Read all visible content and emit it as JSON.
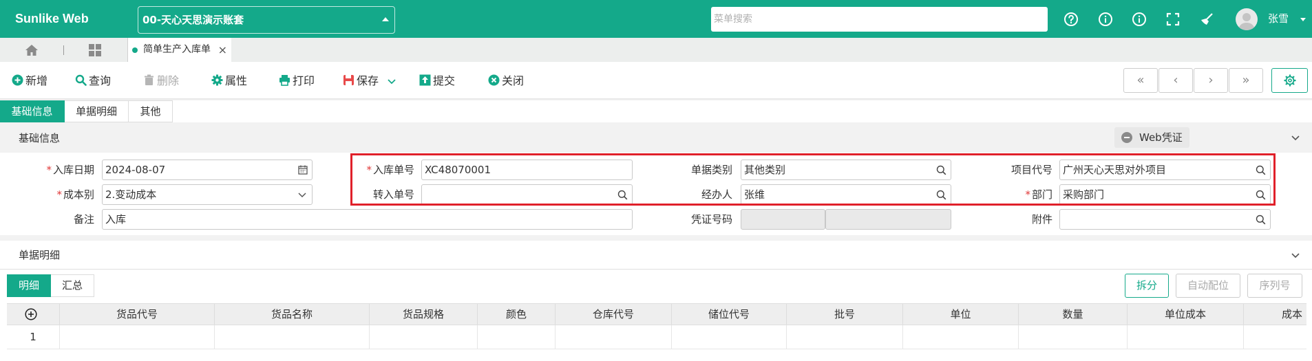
{
  "app": {
    "brand": "Sunlike Web",
    "account": "00-天心天思演示账套"
  },
  "search": {
    "placeholder": "菜单搜索"
  },
  "user": {
    "name": "张雪"
  },
  "tabs": {
    "document_tab": "简单生产入库单"
  },
  "toolbar": {
    "add": "新增",
    "query": "查询",
    "delete": "删除",
    "properties": "属性",
    "print": "打印",
    "save": "保存",
    "submit": "提交",
    "close": "关闭"
  },
  "section_tabs": [
    "基础信息",
    "单据明细",
    "其他"
  ],
  "basic_section": {
    "title": "基础信息",
    "voucher_button": "Web凭证"
  },
  "form": {
    "in_date": {
      "label": "入库日期",
      "value": "2024-08-07"
    },
    "cost_type": {
      "label": "成本别",
      "value": "2.变动成本"
    },
    "remark": {
      "label": "备注",
      "value": "入库"
    },
    "in_no": {
      "label": "入库单号",
      "value": "XC48070001"
    },
    "transfer_no": {
      "label": "转入单号",
      "value": ""
    },
    "doc_type": {
      "label": "单据类别",
      "value": "其他类别"
    },
    "handler": {
      "label": "经办人",
      "value": "张维"
    },
    "voucher_no": {
      "label": "凭证号码",
      "value": ""
    },
    "project_code": {
      "label": "项目代号",
      "value": "广州天心天思对外项目"
    },
    "dept": {
      "label": "部门",
      "value": "采购部门"
    },
    "attachment": {
      "label": "附件",
      "value": ""
    }
  },
  "detail_section": {
    "title": "单据明细"
  },
  "detail_tabs": [
    "明细",
    "汇总"
  ],
  "detail_buttons": {
    "split": "拆分",
    "auto_alloc": "自动配位",
    "serial": "序列号"
  },
  "table": {
    "columns": [
      "货品代号",
      "货品名称",
      "货品规格",
      "颜色",
      "仓库代号",
      "储位代号",
      "批号",
      "单位",
      "数量",
      "单位成本",
      "成本"
    ],
    "rows": [
      {
        "index": "1"
      }
    ]
  },
  "colors": {
    "brand": "#14a98a",
    "highlight": "#e0202a"
  }
}
